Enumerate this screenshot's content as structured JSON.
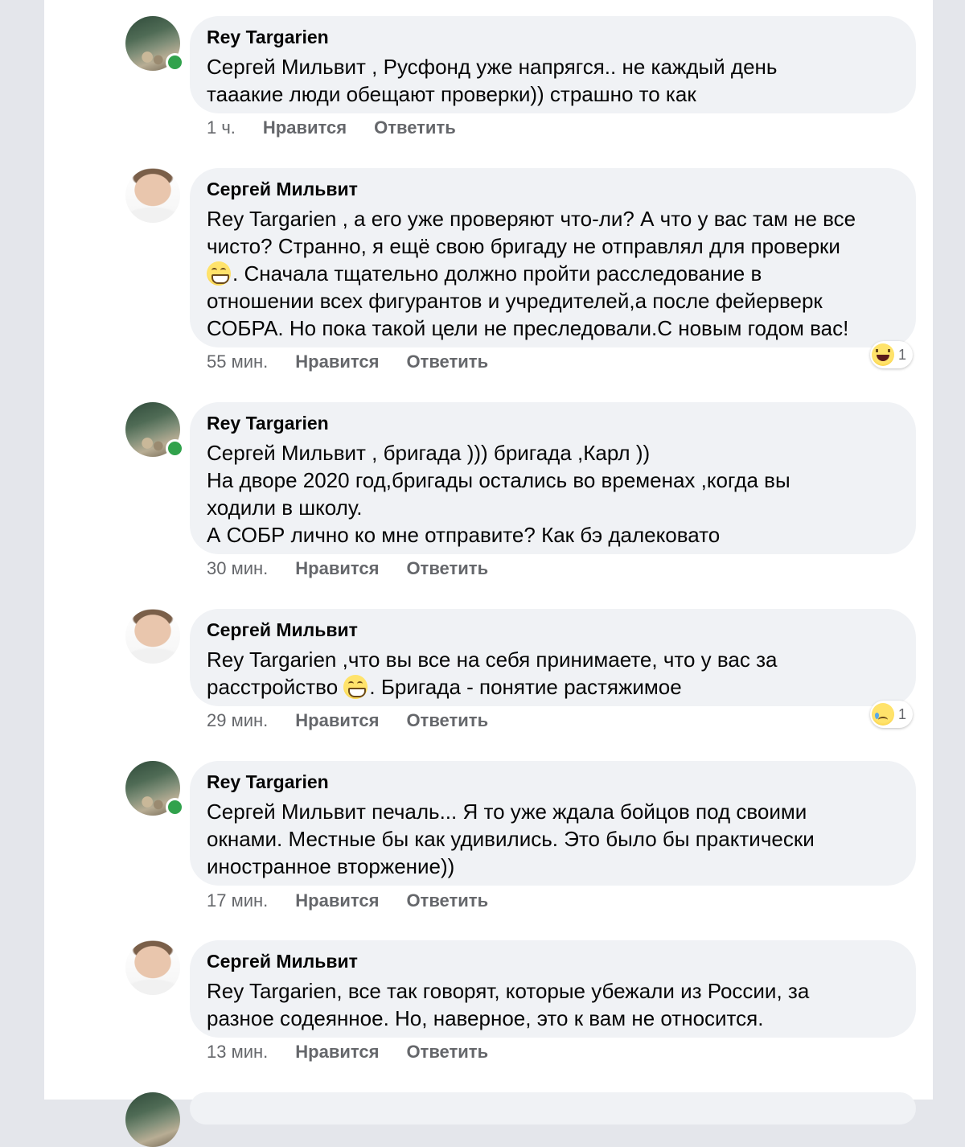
{
  "comments": [
    {
      "author": "Rey Targarien",
      "lines": [
        "Сергей Мильвит , Русфонд уже напрягся.. не каждый день",
        "тааакие люди обещают проверки)) страшно то как"
      ],
      "time": "1 ч.",
      "like": "Нравится",
      "reply": "Ответить"
    },
    {
      "author": "Сергей Мильвит",
      "lines": [
        "Rey Targarien , а его уже проверяют что-ли? А что у вас там не все",
        "чисто? Странно, я ещё свою бригаду не отправлял для проверки",
        ". Сначала тщательно должно пройти расследование в",
        "отношении всех фигурантов и учредителей,а после фейерверк",
        "СОБРА. Но пока такой цели не преследовали.С новым годом вас!"
      ],
      "time": "55 мин.",
      "like": "Нравится",
      "reply": "Ответить",
      "reaction": {
        "icon": "haha-reaction-icon",
        "count": "1"
      }
    },
    {
      "author": "Rey Targarien",
      "lines": [
        "Сергей Мильвит , бригада ))) бригада ,Карл ))",
        "На дворе 2020 год,бригады остались во временах ,когда вы",
        "ходили в школу.",
        "А СОБР лично ко мне отправите? Как бэ далековато"
      ],
      "time": "30 мин.",
      "like": "Нравится",
      "reply": "Ответить"
    },
    {
      "author": "Сергей Мильвит",
      "lines": [
        "Rey Targarien ,что вы все на себя принимаете, что у вас за",
        "расстройство",
        ". Бригада - понятие растяжимое"
      ],
      "time": "29 мин.",
      "like": "Нравится",
      "reply": "Ответить",
      "reaction": {
        "icon": "sad-reaction-icon",
        "count": "1"
      }
    },
    {
      "author": "Rey Targarien",
      "lines": [
        "Сергей Мильвит  печаль... Я то уже ждала бойцов под своими",
        "окнами. Местные бы как удивились. Это было бы практически",
        "иностранное вторжение))"
      ],
      "time": "17 мин.",
      "like": "Нравится",
      "reply": "Ответить"
    },
    {
      "author": "Сергей Мильвит",
      "lines": [
        "Rey Targarien, все так говорят, которые убежали из России, за",
        "разное содеянное. Но, наверное,  это к вам не относится."
      ],
      "time": "13 мин.",
      "like": "Нравится",
      "reply": "Ответить"
    }
  ],
  "colors": {
    "background": "#e4e6eb",
    "bubble": "#f0f2f5",
    "text": "#050505",
    "meta": "#65676b",
    "online": "#31a24c"
  }
}
